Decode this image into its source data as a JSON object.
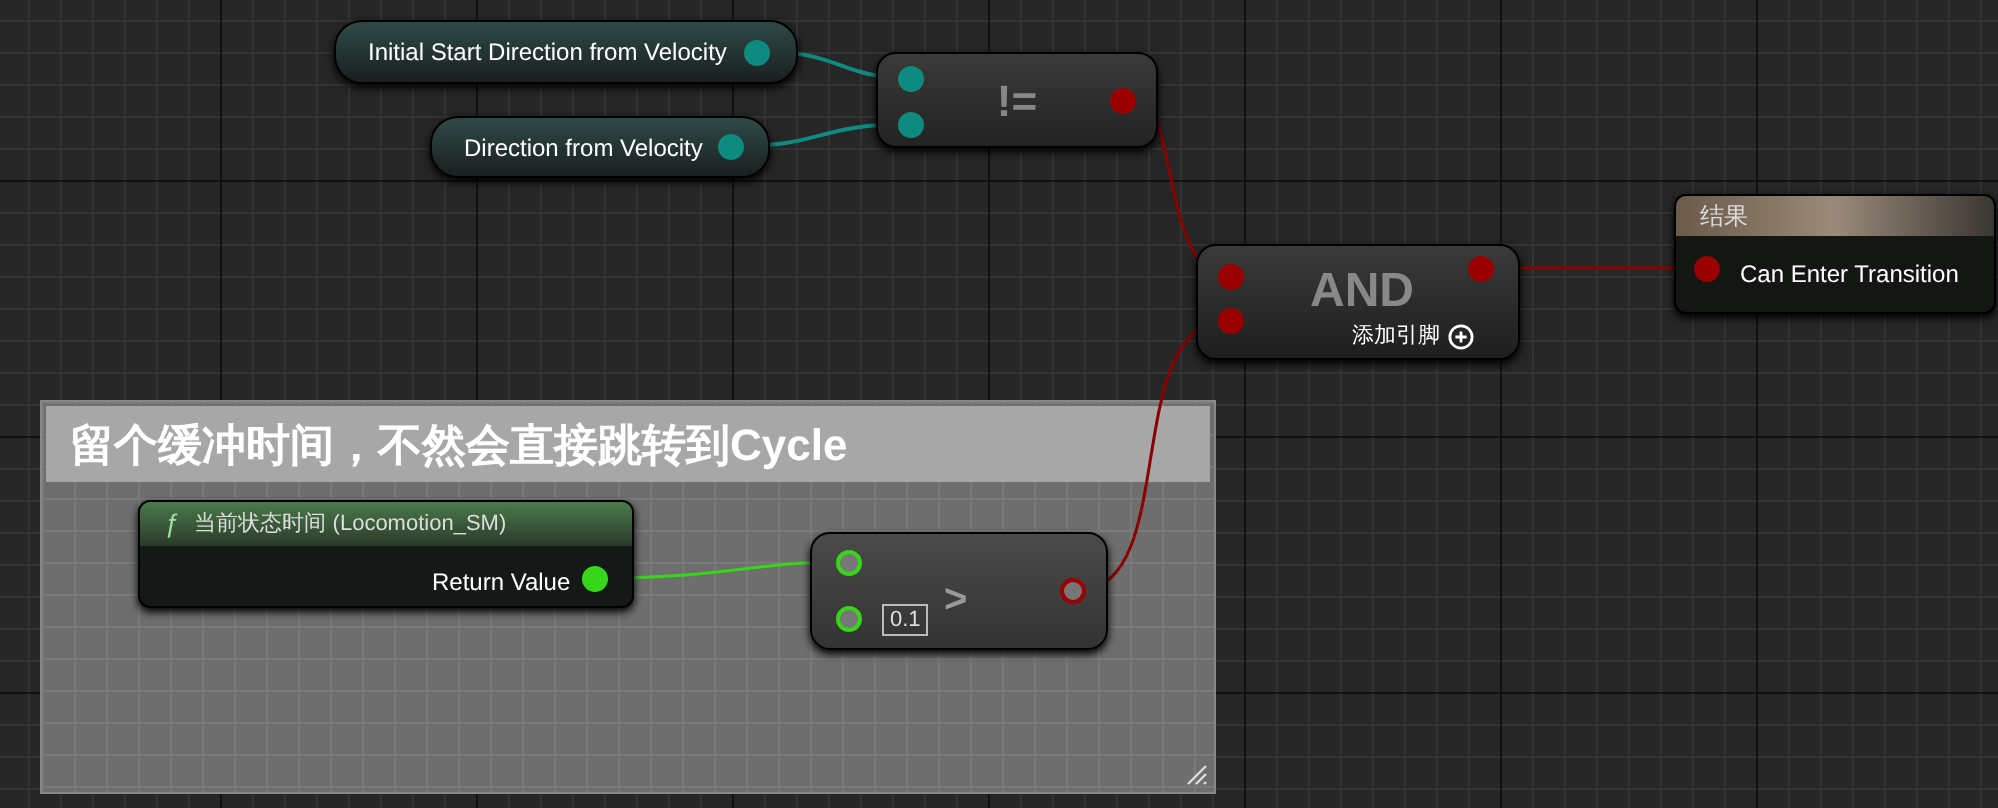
{
  "variable_nodes": [
    {
      "label": "Initial Start Direction from Velocity",
      "pin_filled": true
    },
    {
      "label": "Direction from Velocity",
      "pin_filled": true
    }
  ],
  "not_equal_node": {
    "symbol": "!=",
    "inputs_filled": [
      true,
      true
    ],
    "output_filled": true
  },
  "and_node": {
    "title": "AND",
    "add_pin_label": "添加引脚",
    "inputs_filled": [
      true,
      true
    ],
    "output_filled": true
  },
  "result_node": {
    "title": "结果",
    "pin_label": "Can Enter Transition",
    "pin_filled": true
  },
  "comment": {
    "text": "留个缓冲时间，不然会直接跳转到Cycle"
  },
  "function_node": {
    "glyph": "ƒ",
    "title": "当前状态时间 (Locomotion_SM)",
    "output_label": "Return Value",
    "pin_filled": true
  },
  "greater_node": {
    "symbol": ">",
    "default_value": "0.1",
    "inputs_filled": [
      false,
      false
    ],
    "output_filled": false
  }
}
